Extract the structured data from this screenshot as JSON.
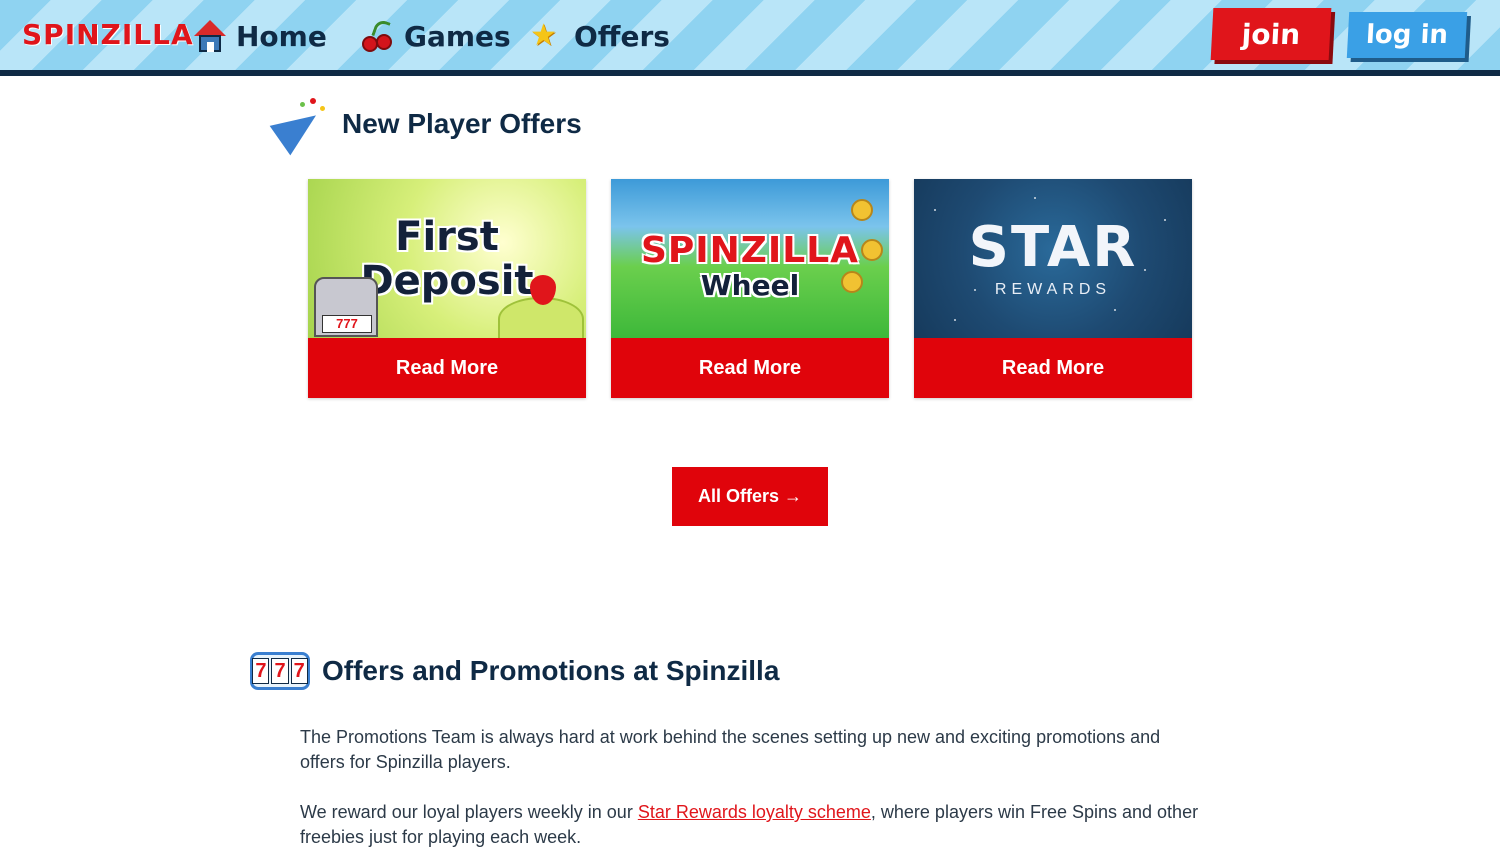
{
  "header": {
    "logo": "SPINZILLA",
    "nav": [
      {
        "label": "Home",
        "icon": "home-icon"
      },
      {
        "label": "Games",
        "icon": "cherry-icon"
      },
      {
        "label": "Offers",
        "icon": "star-icon"
      }
    ],
    "join_label": "join",
    "login_label": "log in"
  },
  "new_player": {
    "title": "New Player Offers",
    "cards": [
      {
        "image_line1": "First",
        "image_line2": "Deposit",
        "slot_digits": "777",
        "button": "Read More"
      },
      {
        "image_line1": "SPINZILLA",
        "image_line2": "Wheel",
        "button": "Read More"
      },
      {
        "image_line1": "STAR",
        "image_line2": "REWARDS",
        "button": "Read More"
      }
    ],
    "all_offers_label": "All Offers →"
  },
  "promotions": {
    "title": "Offers and Promotions at Spinzilla",
    "slot_digits": [
      "7",
      "7",
      "7"
    ],
    "para1": "The Promotions Team is always hard at work behind the scenes setting up new and exciting promotions and offers for Spinzilla players.",
    "para2_before": "We reward our loyal players weekly in our ",
    "para2_link": "Star Rewards loyalty scheme",
    "para2_after": ", where players win Free Spins and other freebies just for playing each week."
  },
  "colors": {
    "brand_red": "#e0040b",
    "navy": "#0f2a45",
    "sky": "#8fd3f1"
  }
}
